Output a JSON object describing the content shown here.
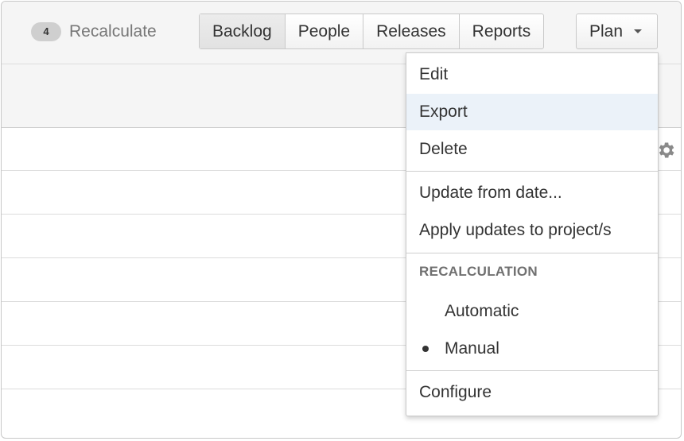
{
  "toolbar": {
    "recalculate_count": "4",
    "recalculate_label": "Recalculate",
    "nav": [
      {
        "label": "Backlog",
        "active": true
      },
      {
        "label": "People",
        "active": false
      },
      {
        "label": "Releases",
        "active": false
      },
      {
        "label": "Reports",
        "active": false
      }
    ],
    "plan_label": "Plan"
  },
  "plan_menu": {
    "items_group1": [
      "Edit",
      "Export",
      "Delete"
    ],
    "hovered_item": "Export",
    "items_group2": [
      "Update from date...",
      "Apply updates to project/s"
    ],
    "recalculation_heading": "RECALCULATION",
    "recalculation_options": [
      {
        "label": "Automatic",
        "selected": false
      },
      {
        "label": "Manual",
        "selected": true
      }
    ],
    "configure_label": "Configure"
  },
  "icons": {
    "settings": "gear-icon",
    "dropdown": "caret-down-icon"
  },
  "colors": {
    "hover_bg": "#ebf2f9",
    "toolbar_bg": "#f5f5f5",
    "badge_bg": "#cfcfcf"
  }
}
